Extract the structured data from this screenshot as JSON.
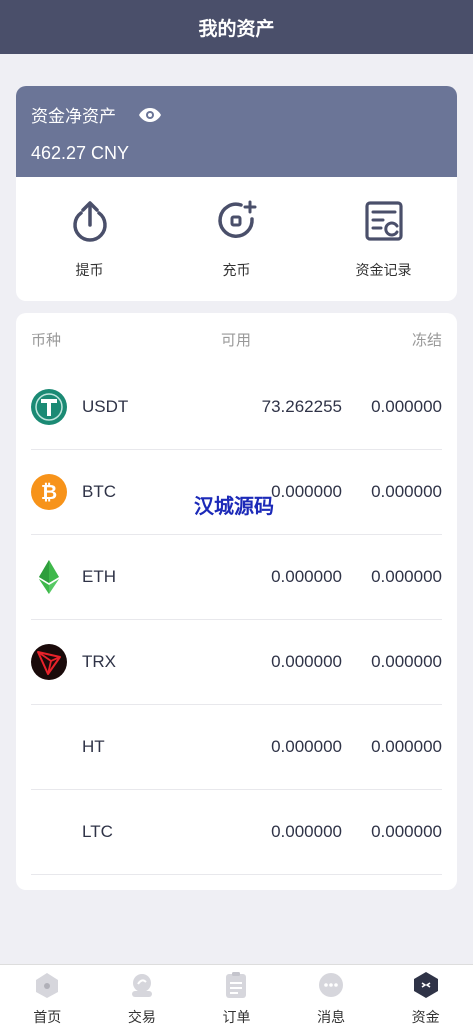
{
  "header": {
    "title": "我的资产"
  },
  "asset": {
    "title": "资金净资产",
    "value": "462.27 CNY",
    "eye_icon": "eye-icon"
  },
  "actions": [
    {
      "label": "提币",
      "icon": "withdraw-icon"
    },
    {
      "label": "充币",
      "icon": "deposit-icon"
    },
    {
      "label": "资金记录",
      "icon": "record-icon"
    }
  ],
  "table": {
    "headers": {
      "coin": "币种",
      "available": "可用",
      "frozen": "冻结"
    },
    "rows": [
      {
        "coin": "USDT",
        "available": "73.262255",
        "frozen": "0.000000",
        "icon": "usdt-icon"
      },
      {
        "coin": "BTC",
        "available": "0.000000",
        "frozen": "0.000000",
        "icon": "btc-icon"
      },
      {
        "coin": "ETH",
        "available": "0.000000",
        "frozen": "0.000000",
        "icon": "eth-icon"
      },
      {
        "coin": "TRX",
        "available": "0.000000",
        "frozen": "0.000000",
        "icon": "trx-icon"
      },
      {
        "coin": "HT",
        "available": "0.000000",
        "frozen": "0.000000",
        "icon": ""
      },
      {
        "coin": "LTC",
        "available": "0.000000",
        "frozen": "0.000000",
        "icon": ""
      }
    ]
  },
  "watermark": "汉城源码",
  "tabbar": [
    {
      "label": "首页",
      "icon": "home-icon",
      "active": false
    },
    {
      "label": "交易",
      "icon": "trade-icon",
      "active": false
    },
    {
      "label": "订单",
      "icon": "order-icon",
      "active": false
    },
    {
      "label": "消息",
      "icon": "message-icon",
      "active": false
    },
    {
      "label": "资金",
      "icon": "assets-icon",
      "active": true
    }
  ],
  "colors": {
    "header_bg": "#4a4f6a",
    "asset_bg": "#6b7597",
    "icon_color": "#4a4f6a",
    "watermark": "#1c2ab8"
  }
}
